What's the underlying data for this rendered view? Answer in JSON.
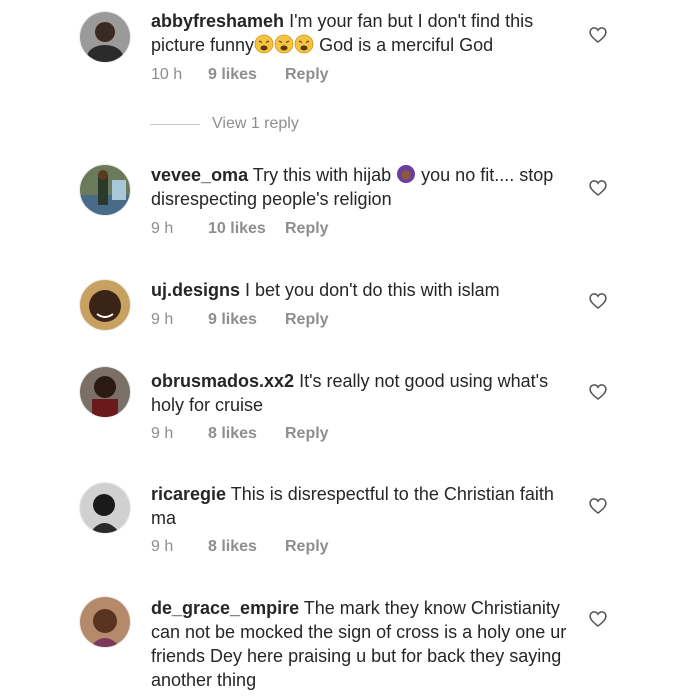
{
  "comments": [
    {
      "username": "abbyfreshameh",
      "text_before": "I'm your fan but I don't find this picture funny",
      "text_after": " God is a merciful God",
      "time": "10 h",
      "likes": "9 likes",
      "reply": "Reply",
      "view_replies": "View 1 reply"
    },
    {
      "username": "vevee_oma",
      "text_before": "Try this with hijab ",
      "text_after": " you no fit.... stop disrespecting people's religion",
      "time": "9 h",
      "likes": "10 likes",
      "reply": "Reply"
    },
    {
      "username": "uj.designs",
      "text": "I bet you don't do this with islam",
      "time": "9 h",
      "likes": "9 likes",
      "reply": "Reply"
    },
    {
      "username": "obrusmados.xx2",
      "text": "It's really not good using what's holy for cruise",
      "time": "9 h",
      "likes": "8 likes",
      "reply": "Reply"
    },
    {
      "username": "ricaregie",
      "text": "This is disrespectful to the Christian faith ma",
      "time": "9 h",
      "likes": "8 likes",
      "reply": "Reply"
    },
    {
      "username": "de_grace_empire",
      "text": "The mark they know Christianity can not be mocked the sign of cross is a holy one ur friends Dey here praising u but for back they saying another thing"
    }
  ],
  "icons": {
    "heart": "heart-outline-icon",
    "weary_emoji": "weary-face-emoji",
    "hijab_emoji": "woman-with-headscarf-emoji"
  },
  "colors": {
    "text": "#262626",
    "meta": "#8e8e8e"
  }
}
